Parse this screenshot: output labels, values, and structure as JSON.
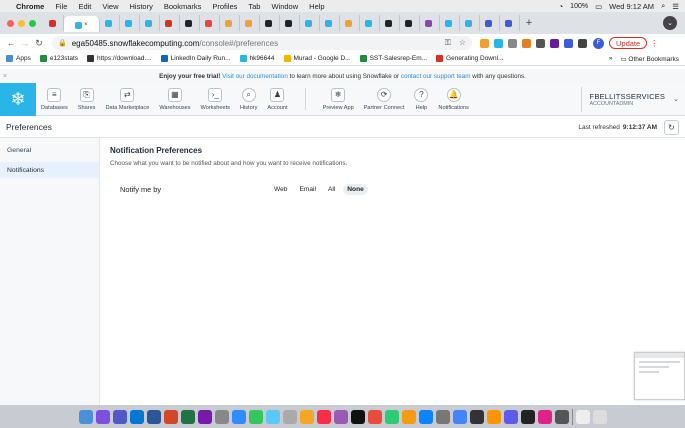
{
  "menubar": {
    "app": "Chrome",
    "items": [
      "File",
      "Edit",
      "View",
      "History",
      "Bookmarks",
      "Profiles",
      "Tab",
      "Window",
      "Help"
    ],
    "battery": "100%",
    "clock": "Wed 9:12 AM"
  },
  "address": {
    "host": "ega50485.snowflakecomputing.com",
    "path": "/console#/preferences",
    "update_label": "Update"
  },
  "bookmarks": {
    "items": [
      "Apps",
      "e123stats",
      "https://download....",
      "LinkedIn Daily Run...",
      "hk96644",
      "Murad - Google D...",
      "SST-Salesrep-Em...",
      "Generating Downl..."
    ],
    "more": "»",
    "other": "Other Bookmarks"
  },
  "banner": {
    "lead": "Enjoy your free trial!",
    "link1": "Visit our documentation",
    "mid1": "to learn more about using Snowflake or",
    "link2": "contact our support team",
    "tail": "with any questions.",
    "close": "×"
  },
  "nav": {
    "items": [
      {
        "label": "Databases",
        "icon": "≡"
      },
      {
        "label": "Shares",
        "icon": "⎘"
      },
      {
        "label": "Data Marketplace",
        "icon": "⇄"
      },
      {
        "label": "Warehouses",
        "icon": "▦"
      },
      {
        "label": "Worksheets",
        "icon": "›_"
      },
      {
        "label": "History",
        "icon": "⌕"
      },
      {
        "label": "Account",
        "icon": "♟"
      }
    ],
    "right_items": [
      {
        "label": "Preview App",
        "icon": "❄"
      },
      {
        "label": "Partner Connect",
        "icon": "⟳"
      },
      {
        "label": "Help",
        "icon": "?"
      },
      {
        "label": "Notifications",
        "icon": "🔔"
      }
    ]
  },
  "user": {
    "name": "FBELLITSSERVICES",
    "role": "ACCOUNTADMIN"
  },
  "page": {
    "title": "Preferences",
    "refreshed_label": "Last refreshed",
    "refreshed_time": "9:12:37 AM"
  },
  "sidebar": {
    "items": [
      {
        "label": "General"
      },
      {
        "label": "Notifications"
      }
    ]
  },
  "main": {
    "heading": "Notification Preferences",
    "subheading": "Choose what you want to be notified about and how you want to receive notifications.",
    "notify_label": "Notify me by",
    "options": [
      "Web",
      "Email",
      "All",
      "None"
    ],
    "selected": "None"
  }
}
